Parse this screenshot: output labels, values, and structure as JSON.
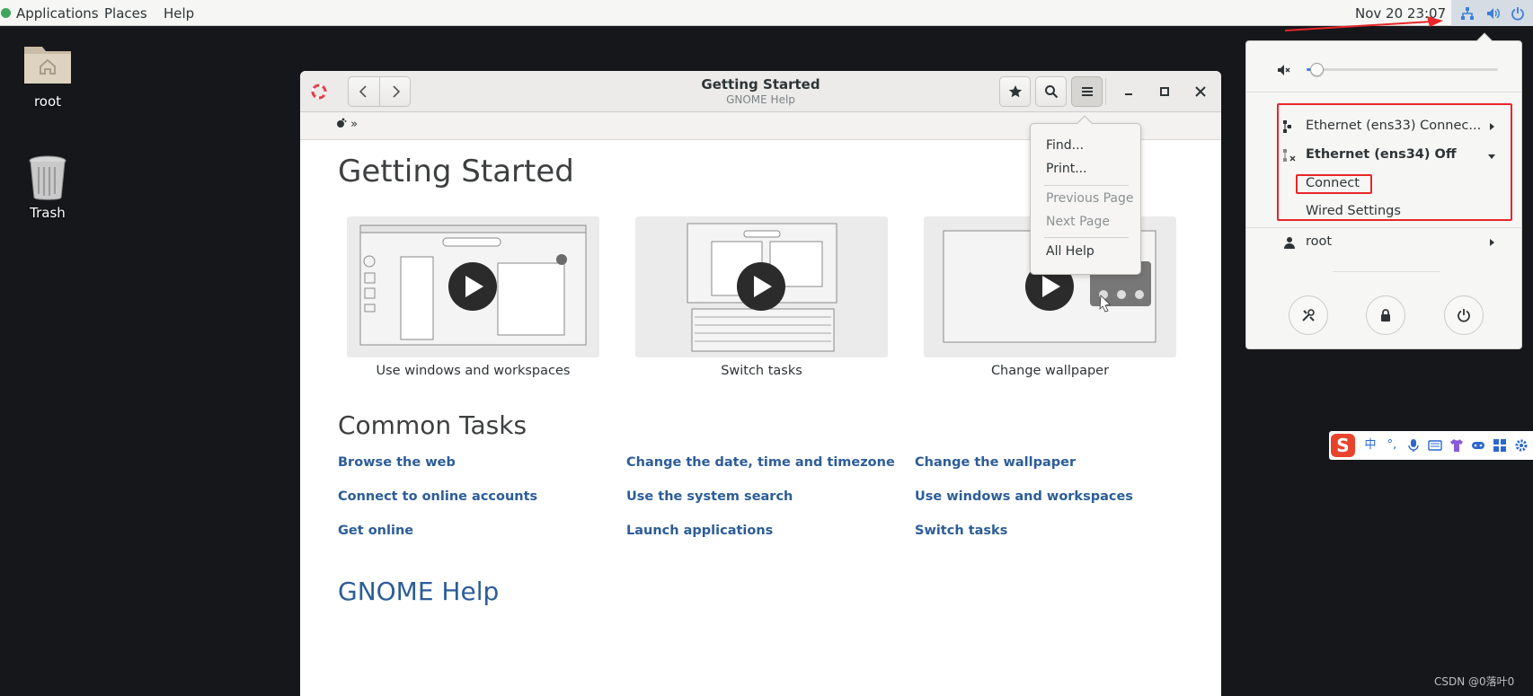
{
  "topbar": {
    "applications": "Applications",
    "places": "Places",
    "help": "Help",
    "clock": "Nov 20  23:07",
    "status_icons": [
      "network-wired-icon",
      "volume-icon",
      "power-icon"
    ]
  },
  "desktop": {
    "items": [
      {
        "label": "root",
        "icon": "home-folder-icon"
      },
      {
        "label": "Trash",
        "icon": "trash-icon"
      }
    ]
  },
  "window": {
    "title": "Getting Started",
    "subtitle": "GNOME Help",
    "breadcrumb_suffix": "»",
    "heading": "Getting Started",
    "videos": [
      {
        "caption": "Use windows and workspaces"
      },
      {
        "caption": "Switch tasks"
      },
      {
        "caption": "Change wallpaper"
      }
    ],
    "common_tasks_heading": "Common Tasks",
    "tasks": [
      [
        "Browse the web",
        "Change the date, time and timezone",
        "Change the wallpaper"
      ],
      [
        "Connect to online accounts",
        "Use the system search",
        "Use windows and workspaces"
      ],
      [
        "Get online",
        "Launch applications",
        "Switch tasks"
      ]
    ],
    "footer_link": "GNOME Help",
    "link_color": "#2c5d98"
  },
  "popover_menu": {
    "items": [
      {
        "label": "Find...",
        "enabled": true
      },
      {
        "label": "Print...",
        "enabled": true
      },
      {
        "label": "Previous Page",
        "enabled": false
      },
      {
        "label": "Next Page",
        "enabled": false
      },
      {
        "label": "All Help",
        "enabled": true
      }
    ]
  },
  "system_menu": {
    "volume": {
      "icon": "audio-volume-muted-icon",
      "level": 0.05
    },
    "network": [
      {
        "label": "Ethernet (ens33) Connec...",
        "icon": "network-wired-icon",
        "expanded": false
      },
      {
        "label": "Ethernet (ens34) Off",
        "icon": "network-wired-disconnected-icon",
        "expanded": true,
        "actions": [
          "Connect",
          "Wired Settings"
        ]
      }
    ],
    "user": {
      "label": "root",
      "icon": "user-icon"
    },
    "buttons": [
      "settings-icon",
      "lock-icon",
      "power-icon"
    ],
    "accent": "#3584e4",
    "highlight": "#e8262a"
  },
  "ime_toolbar": {
    "logo": "S",
    "items": [
      "中",
      "°,",
      "mic-icon",
      "keyboard-icon",
      "shirt-icon",
      "gamepad-icon",
      "grid-icon",
      "gear-icon"
    ]
  },
  "watermark": "CSDN @0落叶0"
}
